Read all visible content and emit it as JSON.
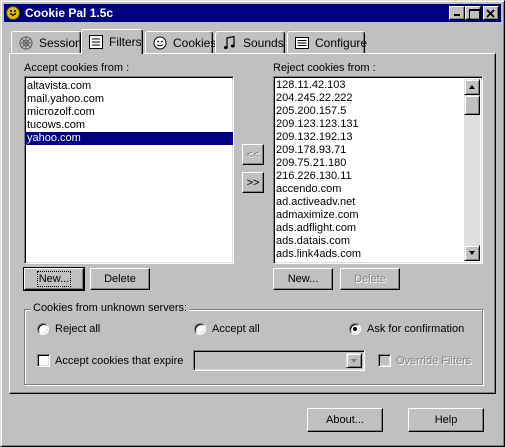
{
  "window": {
    "title": "Cookie Pal 1.5c"
  },
  "tabs": [
    {
      "label": "Session",
      "icon": "spider-web-icon"
    },
    {
      "label": "Filters",
      "icon": "filter-list-icon",
      "active": true
    },
    {
      "label": "Cookies",
      "icon": "cookie-face-icon"
    },
    {
      "label": "Sounds",
      "icon": "music-note-icon"
    },
    {
      "label": "Configure",
      "icon": "configure-panel-icon"
    }
  ],
  "accept": {
    "label": "Accept cookies from :",
    "items": [
      "altavista.com",
      "mail.yahoo.com",
      "microzolf.com",
      "tucows.com",
      "yahoo.com"
    ],
    "selected_item": "yahoo.com",
    "new_label": "New...",
    "delete_label": "Delete"
  },
  "move": {
    "to_accept": "<<",
    "to_reject": ">>"
  },
  "reject": {
    "label": "Reject cookies from :",
    "items": [
      "128.11.42.103",
      "204.245.22.222",
      "205.200.157.5",
      "209.123.123.131",
      "209.132.192.13",
      "209.178.93.71",
      "209.75.21.180",
      "216.226.130.11",
      "accendo.com",
      "ad.activeadv.net",
      "admaximize.com",
      "ads.adflight.com",
      "ads.datais.com",
      "ads.link4ads.com"
    ],
    "new_label": "New...",
    "delete_label": "Delete"
  },
  "unknown": {
    "group_label": "Cookies from unknown servers:",
    "reject_all": "Reject all",
    "accept_all": "Accept all",
    "ask": "Ask for confirmation",
    "selected": "Ask for confirmation",
    "expire_label": "Accept cookies that expire",
    "expire_checked": false,
    "expire_value": "",
    "override_label": "Override Filters"
  },
  "footer": {
    "about_label": "About...",
    "help_label": "Help"
  }
}
